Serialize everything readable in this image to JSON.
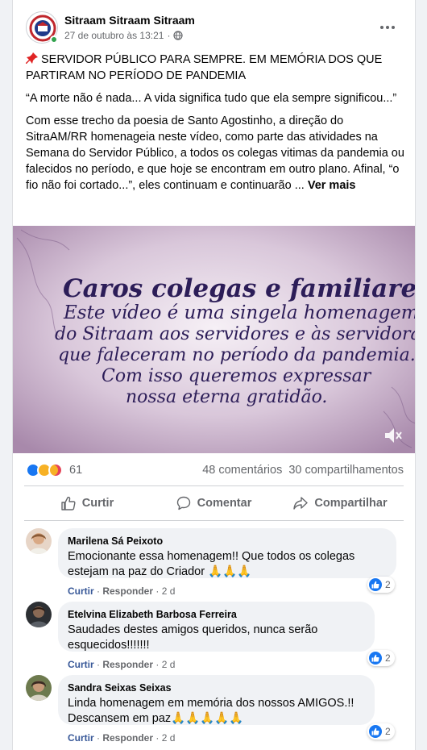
{
  "post": {
    "author": "Sitraam Sitraam Sitraam",
    "timestamp": "27 de outubro às 13:21",
    "separator": "·",
    "title_line": "SERVIDOR PÚBLICO PARA SEMPRE. EM MEMÓRIA DOS QUE PARTIRAM NO PERÍODO DE PANDEMIA",
    "quote": "“A morte não é nada... A vida significa tudo que ela sempre significou...”",
    "body": "Com esse trecho da poesia de Santo Agostinho, a direção do SitraAM/RR homenageia neste vídeo, como parte das atividades na Semana do Servidor Público, a todos os colegas vitimas da pandemia ou falecidos no período, e que hoje se encontram em outro plano. Afinal, “o fio não foi cortado...”, eles continuam e continuarão ...",
    "see_more": "Ver mais"
  },
  "video": {
    "lines": [
      "Caros colegas e familiares.",
      "Este vídeo é uma singela homenagem",
      "do Sitraam aos servidores e às servidoras",
      "que faleceram no período da pandemia.",
      "Com isso queremos expressar",
      "nossa eterna gratidão."
    ]
  },
  "stats": {
    "reactions_count": "61",
    "comments": "48 comentários",
    "shares": "30 compartilhamentos"
  },
  "actions": {
    "like": "Curtir",
    "comment": "Comentar",
    "share": "Compartilhar"
  },
  "comments": [
    {
      "name": "Marilena Sá Peixoto",
      "text_line1": "Emocionante essa homenagem!! Que todos os colegas",
      "text_line2": "estejam na paz do Criador 🙏🙏🙏",
      "like": "Curtir",
      "reply": "Responder",
      "time": "2 d",
      "likes": "2"
    },
    {
      "name": "Etelvina Elizabeth Barbosa Ferreira",
      "text_line1": "Saudades destes amigos queridos, nunca serão",
      "text_line2": "esquecidos!!!!!!!",
      "like": "Curtir",
      "reply": "Responder",
      "time": "2 d",
      "likes": "2"
    },
    {
      "name": "Sandra Seixas Seixas",
      "text_line1": "Linda homenagem em memória dos nossos AMIGOS.!!",
      "text_line2": "Descansem em paz🙏🙏🙏🙏🙏",
      "like": "Curtir",
      "reply": "Responder",
      "time": "2 d",
      "likes": "2"
    }
  ]
}
